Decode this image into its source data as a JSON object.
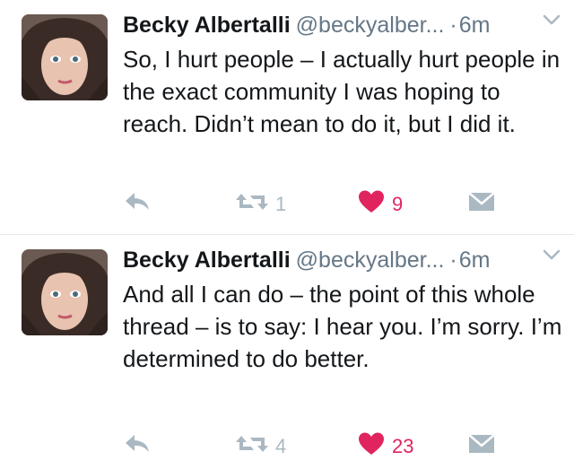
{
  "colors": {
    "text": "#14171a",
    "secondary": "#657786",
    "action_gray": "#aab8c2",
    "like_red": "#e0245e",
    "divider": "#e1e8ed"
  },
  "tweets": [
    {
      "author_name": "Becky Albertalli",
      "handle": "@beckyalber...",
      "separator": "·",
      "time": "6m",
      "text": "So, I hurt people – I actually hurt people in the exact community I was hoping to reach. Didn’t mean to do it, but I did it.",
      "retweet_count": "1",
      "like_count": "9",
      "liked": true,
      "icons": [
        "reply-icon",
        "retweet-icon",
        "heart-icon",
        "direct-message-icon",
        "chevron-down-icon"
      ]
    },
    {
      "author_name": "Becky Albertalli",
      "handle": "@beckyalber...",
      "separator": "·",
      "time": "6m",
      "text": "And all I can do – the point of this whole thread – is to say: I hear you. I’m sorry. I’m determined to do better.",
      "retweet_count": "4",
      "like_count": "23",
      "liked": true,
      "icons": [
        "reply-icon",
        "retweet-icon",
        "heart-icon",
        "direct-message-icon",
        "chevron-down-icon"
      ]
    }
  ]
}
